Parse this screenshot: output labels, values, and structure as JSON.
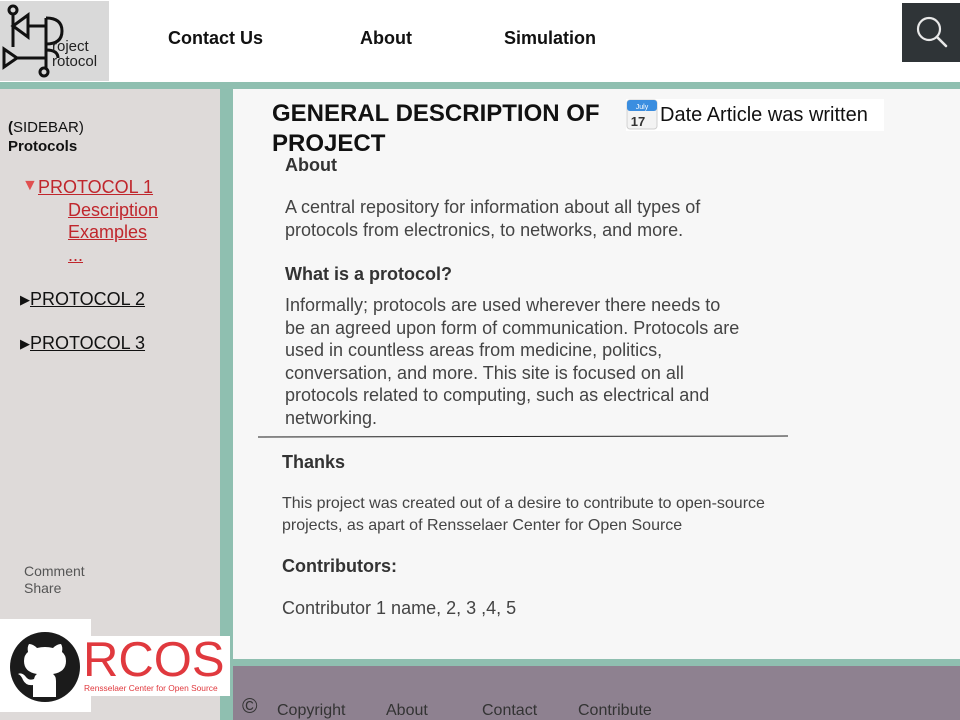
{
  "header": {
    "logo": {
      "line1": "roject",
      "line2": "rotocol"
    },
    "nav": [
      "Contact Us",
      "About",
      "Simulation"
    ],
    "search_icon": "search-icon"
  },
  "sidebar": {
    "label_prefix": "(",
    "label_rest": "SIDEBAR)",
    "heading": "Protocols",
    "protocols": [
      {
        "label": "PROTOCOL 1",
        "expanded": true,
        "subitems": [
          "Description",
          "Examples",
          "..."
        ]
      },
      {
        "label": "PROTOCOL 2",
        "expanded": false
      },
      {
        "label": "PROTOCOL 3",
        "expanded": false
      }
    ],
    "actions": [
      "Comment",
      "Share"
    ]
  },
  "main": {
    "title": "GENERAL DESCRIPTION OF PROJECT",
    "date_label": "Date Article was written",
    "calendar_month": "July",
    "calendar_day": "17",
    "about_heading": "About",
    "about_text": "A central repository for information about all types of protocols from electronics, to networks, and more.",
    "protocol_heading": "What is a protocol?",
    "protocol_text": "Informally; protocols are used wherever there needs to be an agreed upon form of communication. Protocols are used in countless areas from medicine, politics, conversation, and more. This site is focused on all protocols related to computing, such as electrical and networking.",
    "thanks_heading": "Thanks",
    "thanks_text": "This project was created out of a desire to contribute to open-source projects, as apart of Rensselaer Center for Open Source",
    "contributors_heading": "Contributors:",
    "contributors_text": "Contributor 1 name, 2, 3 ,4, 5"
  },
  "logos": {
    "rcos": "RCOS",
    "rcos_sub": "Rensselaer Center for Open Source"
  },
  "footer": {
    "copyright_symbol": "©",
    "links": [
      "Copyright",
      "About",
      "Contact",
      "Contribute"
    ]
  },
  "colors": {
    "accent_teal": "#8fbfb0",
    "sidebar_bg": "#dedad9",
    "footer_bg": "#8e8190",
    "active_link": "#c0262c",
    "rcos_red": "#e0393e"
  }
}
